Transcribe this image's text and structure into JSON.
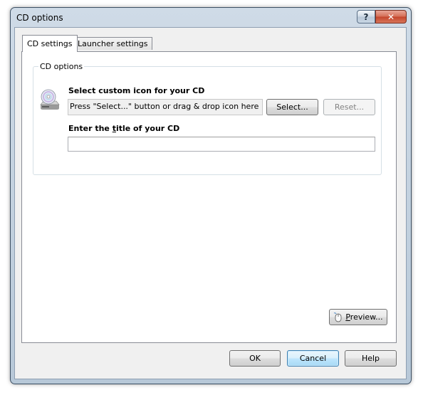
{
  "window": {
    "title": "CD options",
    "help_glyph": "?",
    "close_glyph": "✕"
  },
  "tabs": [
    {
      "label": "CD settings",
      "active": true
    },
    {
      "label": "Launcher settings",
      "active": false
    }
  ],
  "groupbox": {
    "caption": "CD options"
  },
  "icon_section": {
    "label": "Select custom icon for your CD",
    "field_value": "Press \"Select...\" button or drag & drop icon here",
    "select_label": "Select...",
    "reset_label": "Reset...",
    "icon": "cd-drive-icon"
  },
  "title_section": {
    "label_before": "Enter the ",
    "label_accel": "t",
    "label_after": "itle of your CD",
    "value": ""
  },
  "preview": {
    "label_accel": "P",
    "label_rest": "review...",
    "icon": "mouse-icon"
  },
  "footer": {
    "ok_label": "OK",
    "cancel_label": "Cancel",
    "help_label": "Help"
  },
  "colors": {
    "frame": "#b7c8d8",
    "close_button": "#c4452c",
    "default_button_border": "#3c7fb1"
  }
}
